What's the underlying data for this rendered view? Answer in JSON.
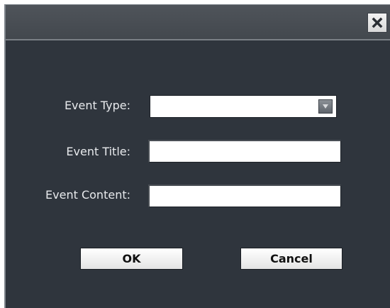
{
  "dialog": {
    "title": "",
    "close_icon": "close-icon"
  },
  "form": {
    "event_type": {
      "label": "Event Type:",
      "selected_value": "",
      "dropdown_icon": "chevron-down-icon"
    },
    "event_title": {
      "label": "Event Title:",
      "value": ""
    },
    "event_content": {
      "label": "Event Content:",
      "value": ""
    }
  },
  "buttons": {
    "ok_label": "OK",
    "cancel_label": "Cancel"
  },
  "colors": {
    "dialog_background": "#2f353d",
    "titlebar_background": "#4a4f55",
    "label_text": "#e8eaed",
    "field_background": "#ffffff"
  }
}
